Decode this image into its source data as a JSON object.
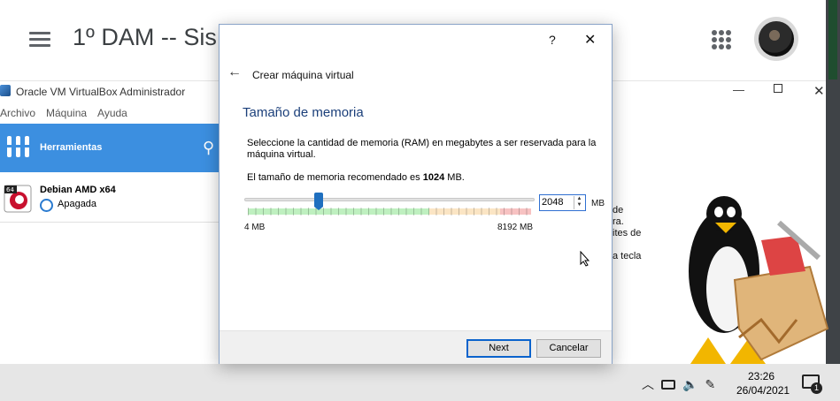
{
  "background": {
    "title": "1º DAM -- Sis"
  },
  "vbox": {
    "title": "Oracle VM VirtualBox Administrador",
    "menu": [
      "Archivo",
      "Máquina",
      "Ayuda"
    ],
    "tools_label": "Herramientas",
    "vm": {
      "name": "Debian AMD x64",
      "state": "Apagada",
      "badge": "64"
    },
    "side_text": [
      "de",
      "ra.",
      "ites de",
      "",
      "a tecla"
    ]
  },
  "dialog": {
    "help": "?",
    "close": "✕",
    "breadcrumb": "Crear máquina virtual",
    "heading": "Tamaño de memoria",
    "description": "Seleccione la cantidad de memoria (RAM) en megabytes a ser reservada para la máquina virtual.",
    "recommended_prefix": "El tamaño de memoria recomendado es",
    "recommended_value": "1024",
    "recommended_unit": "MB.",
    "slider": {
      "min": 4,
      "max": 8192,
      "value": 2048,
      "min_label": "4 MB",
      "max_label": "8192 MB"
    },
    "input_value": "2048",
    "unit": "MB",
    "next_label": "Next",
    "cancel_label": "Cancelar"
  },
  "taskbar": {
    "time": "23:26",
    "date": "26/04/2021",
    "notification_count": "1"
  },
  "colors": {
    "accent": "#3c8fe0",
    "heading": "#1b3f7a",
    "default_button_border": "#0b63cc"
  }
}
